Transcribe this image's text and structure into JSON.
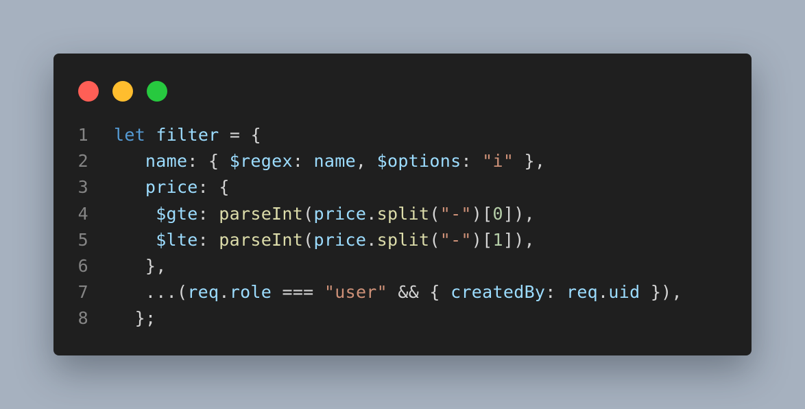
{
  "theme": {
    "background": "#a6b1bf",
    "window_bg": "#1f1f1f",
    "dot_red": "#ff5f56",
    "dot_yellow": "#ffbd2e",
    "dot_green": "#27c93f",
    "line_number": "#858585",
    "keyword": "#569cd6",
    "variable": "#9cdcfe",
    "function": "#dcdcaa",
    "string": "#ce9178",
    "number": "#b5cea8",
    "punctuation": "#d4d4d4"
  },
  "code": {
    "lines": [
      {
        "number": "1",
        "indent": 2,
        "tokens": [
          {
            "t": "let",
            "k": "keyword"
          },
          {
            "t": " ",
            "k": "plain"
          },
          {
            "t": "filter",
            "k": "variable"
          },
          {
            "t": " = {",
            "k": "punct"
          }
        ]
      },
      {
        "number": "2",
        "indent": 5,
        "tokens": [
          {
            "t": "name",
            "k": "property"
          },
          {
            "t": ": { ",
            "k": "punct"
          },
          {
            "t": "$regex",
            "k": "property"
          },
          {
            "t": ": ",
            "k": "punct"
          },
          {
            "t": "name",
            "k": "variable"
          },
          {
            "t": ", ",
            "k": "punct"
          },
          {
            "t": "$options",
            "k": "property"
          },
          {
            "t": ": ",
            "k": "punct"
          },
          {
            "t": "\"i\"",
            "k": "string"
          },
          {
            "t": " },",
            "k": "punct"
          }
        ]
      },
      {
        "number": "3",
        "indent": 5,
        "tokens": [
          {
            "t": "price",
            "k": "property"
          },
          {
            "t": ": {",
            "k": "punct"
          }
        ]
      },
      {
        "number": "4",
        "indent": 6,
        "tokens": [
          {
            "t": "$gte",
            "k": "property"
          },
          {
            "t": ": ",
            "k": "punct"
          },
          {
            "t": "parseInt",
            "k": "function"
          },
          {
            "t": "(",
            "k": "punct"
          },
          {
            "t": "price",
            "k": "variable"
          },
          {
            "t": ".",
            "k": "punct"
          },
          {
            "t": "split",
            "k": "function"
          },
          {
            "t": "(",
            "k": "punct"
          },
          {
            "t": "\"-\"",
            "k": "string"
          },
          {
            "t": ")[",
            "k": "punct"
          },
          {
            "t": "0",
            "k": "number"
          },
          {
            "t": "]),",
            "k": "punct"
          }
        ]
      },
      {
        "number": "5",
        "indent": 6,
        "tokens": [
          {
            "t": "$lte",
            "k": "property"
          },
          {
            "t": ": ",
            "k": "punct"
          },
          {
            "t": "parseInt",
            "k": "function"
          },
          {
            "t": "(",
            "k": "punct"
          },
          {
            "t": "price",
            "k": "variable"
          },
          {
            "t": ".",
            "k": "punct"
          },
          {
            "t": "split",
            "k": "function"
          },
          {
            "t": "(",
            "k": "punct"
          },
          {
            "t": "\"-\"",
            "k": "string"
          },
          {
            "t": ")[",
            "k": "punct"
          },
          {
            "t": "1",
            "k": "number"
          },
          {
            "t": "]),",
            "k": "punct"
          }
        ]
      },
      {
        "number": "6",
        "indent": 5,
        "tokens": [
          {
            "t": "},",
            "k": "punct"
          }
        ]
      },
      {
        "number": "7",
        "indent": 5,
        "tokens": [
          {
            "t": "...(",
            "k": "punct"
          },
          {
            "t": "req",
            "k": "variable"
          },
          {
            "t": ".",
            "k": "punct"
          },
          {
            "t": "role",
            "k": "variable"
          },
          {
            "t": " === ",
            "k": "punct"
          },
          {
            "t": "\"user\"",
            "k": "string"
          },
          {
            "t": " && { ",
            "k": "punct"
          },
          {
            "t": "createdBy",
            "k": "property"
          },
          {
            "t": ": ",
            "k": "punct"
          },
          {
            "t": "req",
            "k": "variable"
          },
          {
            "t": ".",
            "k": "punct"
          },
          {
            "t": "uid",
            "k": "variable"
          },
          {
            "t": " }),",
            "k": "punct"
          }
        ]
      },
      {
        "number": "8",
        "indent": 4,
        "tokens": [
          {
            "t": "};",
            "k": "punct"
          }
        ]
      }
    ]
  }
}
